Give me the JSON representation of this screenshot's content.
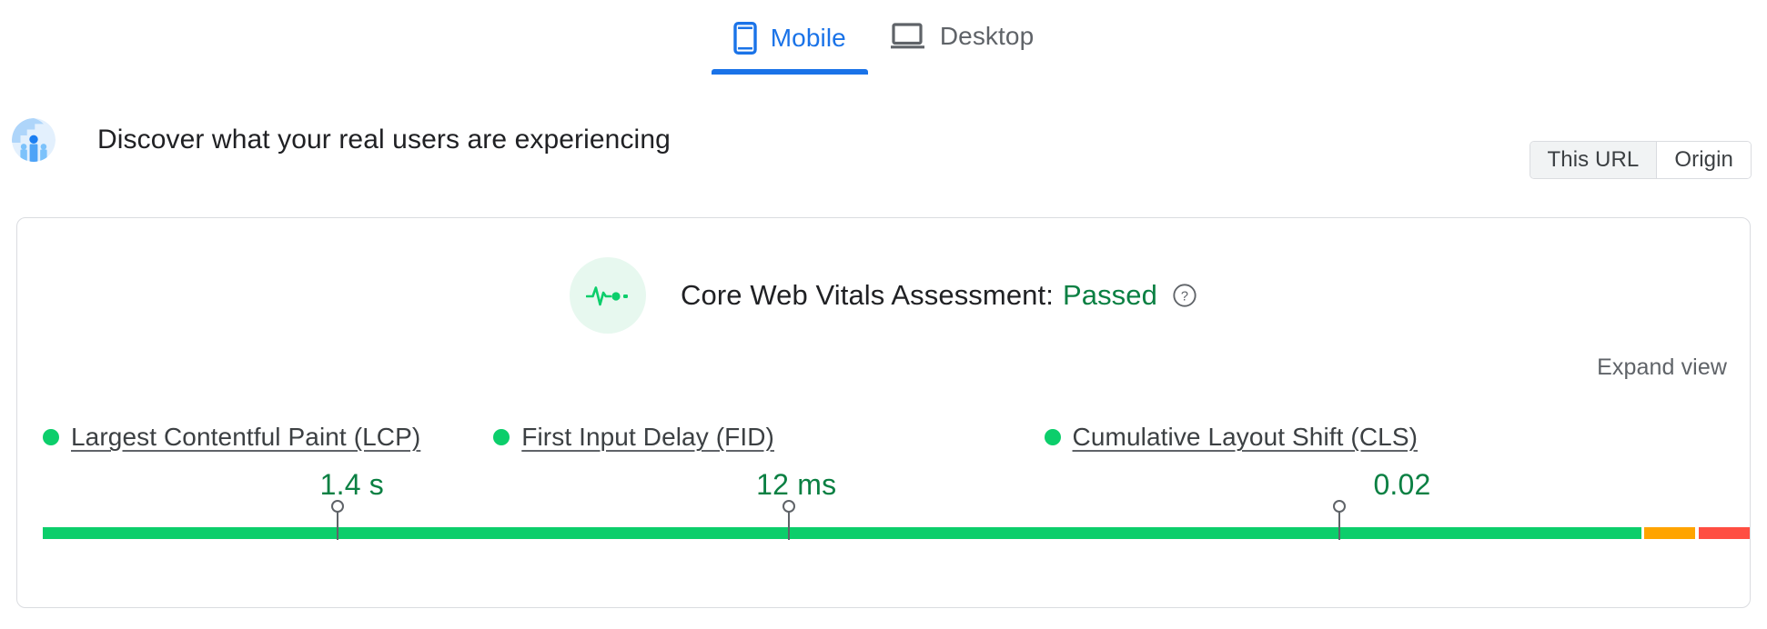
{
  "device_tabs": [
    {
      "id": "mobile",
      "label": "Mobile",
      "icon": "mobile-phone-icon",
      "active": true
    },
    {
      "id": "desktop",
      "label": "Desktop",
      "icon": "laptop-icon",
      "active": false
    }
  ],
  "header": {
    "icon": "real-users-avatar-icon",
    "title": "Discover what your real users are experiencing"
  },
  "scope_toggle": {
    "options": [
      {
        "id": "this-url",
        "label": "This URL",
        "selected": true
      },
      {
        "id": "origin",
        "label": "Origin",
        "selected": false
      }
    ]
  },
  "card": {
    "assessment": {
      "icon": "heartbeat-pulse-icon",
      "label": "Core Web Vitals Assessment:",
      "status": "Passed",
      "status_color": "#0b8043",
      "help_icon": "help-circle-icon"
    },
    "expand_view_label": "Expand view"
  },
  "colors": {
    "good": "#0cce6b",
    "average": "#ffa400",
    "poor": "#ff4e42",
    "accent": "#1a73e8",
    "text": "#202124",
    "muted": "#5f6368",
    "border": "#dadce0",
    "pass_green": "#0b8043"
  },
  "chart_data": {
    "type": "bar",
    "title": "Core Web Vitals Assessment: Passed",
    "legend_position": "none",
    "grid": false,
    "metrics": [
      {
        "id": "lcp",
        "name": "Largest Contentful Paint (LCP)",
        "value": "1.4 s",
        "rating": "good",
        "dot_color": "#0cce6b",
        "marker_percent": 58.3,
        "distribution": [
          {
            "bucket": "good",
            "percent": 91.0,
            "color": "#0cce6b"
          },
          {
            "bucket": "average",
            "percent": 6.5,
            "color": "#ffa400"
          },
          {
            "bucket": "poor",
            "percent": 2.5,
            "color": "#ff4e42"
          }
        ]
      },
      {
        "id": "fid",
        "name": "First Input Delay (FID)",
        "value": "12 ms",
        "rating": "good",
        "dot_color": "#0cce6b",
        "marker_percent": 48.6,
        "distribution": [
          {
            "bucket": "good",
            "percent": 97.9,
            "color": "#0cce6b"
          },
          {
            "bucket": "average",
            "percent": 1.1,
            "color": "#ffa400"
          },
          {
            "bucket": "poor",
            "percent": 1.0,
            "color": "#ff4e42"
          }
        ]
      },
      {
        "id": "cls",
        "name": "Cumulative Layout Shift (CLS)",
        "value": "0.02",
        "rating": "good",
        "dot_color": "#0cce6b",
        "marker_percent": 41.9,
        "distribution": [
          {
            "bucket": "good",
            "percent": 84.6,
            "color": "#0cce6b"
          },
          {
            "bucket": "average",
            "percent": 7.5,
            "color": "#ffa400"
          },
          {
            "bucket": "poor",
            "percent": 7.9,
            "color": "#ff4e42"
          }
        ]
      }
    ],
    "xlabel": "",
    "ylabel": "",
    "ylim": [
      0,
      100
    ]
  }
}
